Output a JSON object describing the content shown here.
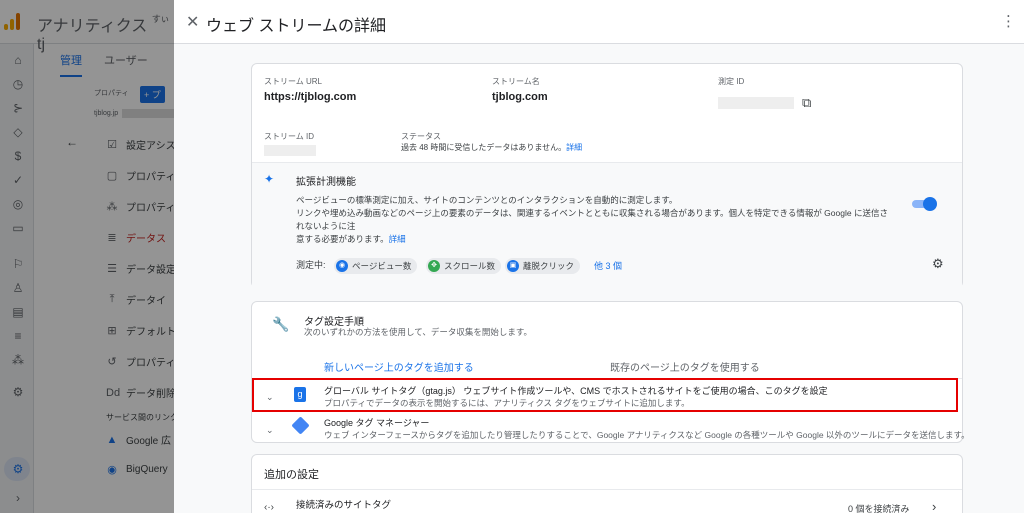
{
  "app": {
    "title": "アナリティクス",
    "title_partial": "tj",
    "small_char": "すぃ"
  },
  "nav": {
    "tab_admin": "管理",
    "tab_user": "ユーザー",
    "property_label": "プロパティ",
    "property_add": "+ プ",
    "property_domain": "tjblog.jp"
  },
  "bg_menu": [
    {
      "label": "設定アシス",
      "icon": "checkbox-icon"
    },
    {
      "label": "プロパティ",
      "icon": "window-icon"
    },
    {
      "label": "プロパティ",
      "icon": "people-icon"
    },
    {
      "label": "データス",
      "icon": "stream-icon"
    },
    {
      "label": "データ設定",
      "icon": "database-icon"
    },
    {
      "label": "データイ",
      "icon": "upload-icon"
    },
    {
      "label": "デフォルト",
      "icon": "table-icon"
    },
    {
      "label": "プロパティ",
      "icon": "history-icon"
    },
    {
      "label": "データ削除",
      "icon": "dd-icon"
    }
  ],
  "service_links": {
    "heading": "サービス間のリンク",
    "google_ads": "Google 広",
    "bigquery": "BigQuery"
  },
  "panel": {
    "title": "ウェブ ストリームの詳細"
  },
  "stream": {
    "url_label": "ストリーム URL",
    "url": "https://tjblog.com",
    "name_label": "ストリーム名",
    "name": "tjblog.com",
    "mid_label": "測定 ID",
    "id_label": "ストリーム ID",
    "status_label": "ステータス",
    "status": "過去 48 時間に受信したデータはありません。",
    "status_link": "詳細"
  },
  "enhanced": {
    "title": "拡張計測機能",
    "desc1": "ページビューの標準測定に加え、サイトのコンテンツとのインタラクションを自動的に測定します。",
    "desc2": "リンクや埋め込み動画などのページ上の要素のデータは、関連するイベントとともに収集される場合があります。個人を特定できる情報が Google に送信されないように注",
    "desc3": "意する必要があります。",
    "desc_link": "詳細",
    "measuring": "測定中:",
    "chips": [
      "ページビュー数",
      "スクロール数",
      "離脱クリック"
    ],
    "more": "他 3 個"
  },
  "tagging": {
    "title": "タグ設定手順",
    "subtitle": "次のいずれかの方法を使用して、データ収集を開始します。",
    "tab_new": "新しいページ上のタグを追加する",
    "tab_existing": "既存のページ上のタグを使用する",
    "gtag_title": "グローバル サイトタグ（gtag.js） ウェブサイト作成ツールや、CMS でホストされるサイトをご使用の場合、このタグを設定",
    "gtag_desc": "プロパティでデータの表示を開始するには、アナリティクス タグをウェブサイトに追加します。",
    "gtm_title": "Google タグ マネージャー",
    "gtm_desc": "ウェブ インターフェースからタグを追加したり管理したりすることで、Google アナリティクスなど Google の各種ツールや Google 以外のツールにデータを送信します。"
  },
  "additional": {
    "heading": "追加の設定",
    "connected_tags": "接続済みのサイトタグ",
    "connected_count": "0 個を接続済み"
  }
}
